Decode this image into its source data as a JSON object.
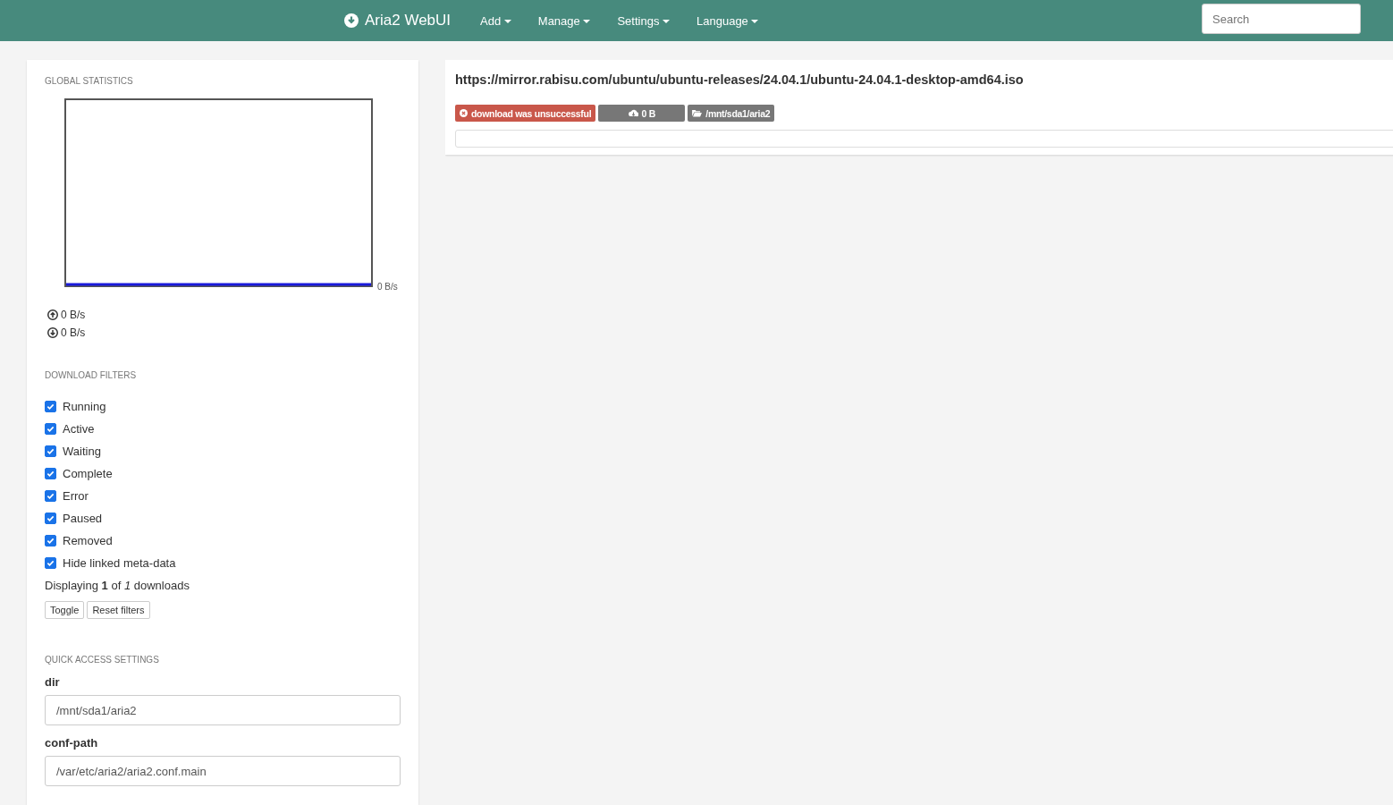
{
  "navbar": {
    "brand": "Aria2 WebUI",
    "menus": [
      {
        "label": "Add"
      },
      {
        "label": "Manage"
      },
      {
        "label": "Settings"
      },
      {
        "label": "Language"
      }
    ],
    "search": {
      "placeholder": "Search"
    }
  },
  "sidebar": {
    "stats": {
      "heading": "GLOBAL STATISTICS",
      "graph_label": "0 B/s",
      "upload": "0 B/s",
      "download": "0 B/s"
    },
    "filters": {
      "heading": "DOWNLOAD FILTERS",
      "items": [
        {
          "label": "Running",
          "checked": true
        },
        {
          "label": "Active",
          "checked": true
        },
        {
          "label": "Waiting",
          "checked": true
        },
        {
          "label": "Complete",
          "checked": true
        },
        {
          "label": "Error",
          "checked": true
        },
        {
          "label": "Paused",
          "checked": true
        },
        {
          "label": "Removed",
          "checked": true
        },
        {
          "label": "Hide linked meta-data",
          "checked": true
        }
      ],
      "summary": "Displaying **1** of *1* downloads",
      "buttons": [
        "Toggle",
        "Reset filters"
      ]
    },
    "quick_settings": {
      "heading": "QUICK ACCESS SETTINGS",
      "fields": [
        {
          "label": "dir",
          "value": "/mnt/sda1/aria2"
        },
        {
          "label": "conf-path",
          "value": "/var/etc/aria2/aria2.conf.main"
        }
      ]
    }
  },
  "downloads": [
    {
      "name": "https://mirror.rabisu.com/ubuntu/ubuntu-releases/24.04.1/ubuntu-24.04.1-desktop-amd64.iso",
      "badges": [
        {
          "kind": "status",
          "text": "download was unsuccessful",
          "color": "#c9574a"
        },
        {
          "kind": "size",
          "text": "0 B",
          "color": "#777777"
        },
        {
          "kind": "dir",
          "text": "/mnt/sda1/aria2",
          "color": "#777777"
        }
      ],
      "level": 0
    }
  ]
}
